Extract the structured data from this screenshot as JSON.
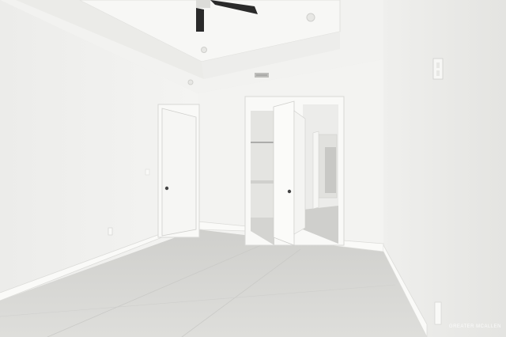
{
  "photo": {
    "subject": "empty-bedroom",
    "watermark_text": "GREATER MCALLEN"
  },
  "colors": {
    "wall": "#f3f3f1",
    "wall_shadow": "#e6e6e3",
    "ceiling": "#f6f6f4",
    "floor": "#d9d9d6",
    "door": "#f8f8f6",
    "fan": "#2a2a2a"
  }
}
